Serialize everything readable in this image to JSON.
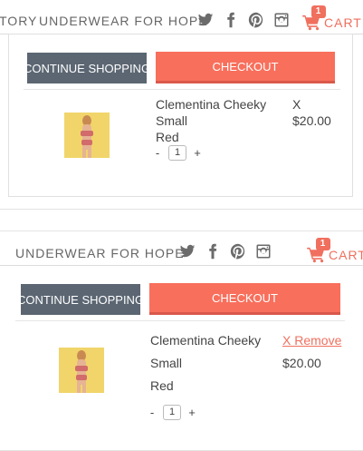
{
  "header_a": {
    "brand_partial": "TORY",
    "brand": "UNDERWEAR FOR HOPE",
    "cart_label": "CART",
    "cart_count": "1"
  },
  "header_b": {
    "brand": "UNDERWEAR FOR HOPE",
    "cart_label": "CART",
    "cart_count": "1"
  },
  "social_icons": [
    "twitter-icon",
    "facebook-icon",
    "pinterest-icon",
    "instagram-icon"
  ],
  "buttons": {
    "continue": "CONTINUE SHOPPING",
    "checkout": "CHECKOUT"
  },
  "item_a": {
    "name": "Clementina Cheeky",
    "size": "Small",
    "color": "Red",
    "remove": "X",
    "price": "$20.00",
    "qty": "1",
    "minus": "-",
    "plus": "+"
  },
  "item_b": {
    "name": "Clementina Cheeky",
    "size": "Small",
    "color": "Red",
    "remove": "X Remove",
    "price": "$20.00",
    "qty": "1",
    "minus": "-",
    "plus": "+"
  },
  "colors": {
    "accent": "#f06f5e",
    "checkout": "#f86f5c",
    "continue": "#5b6672"
  }
}
